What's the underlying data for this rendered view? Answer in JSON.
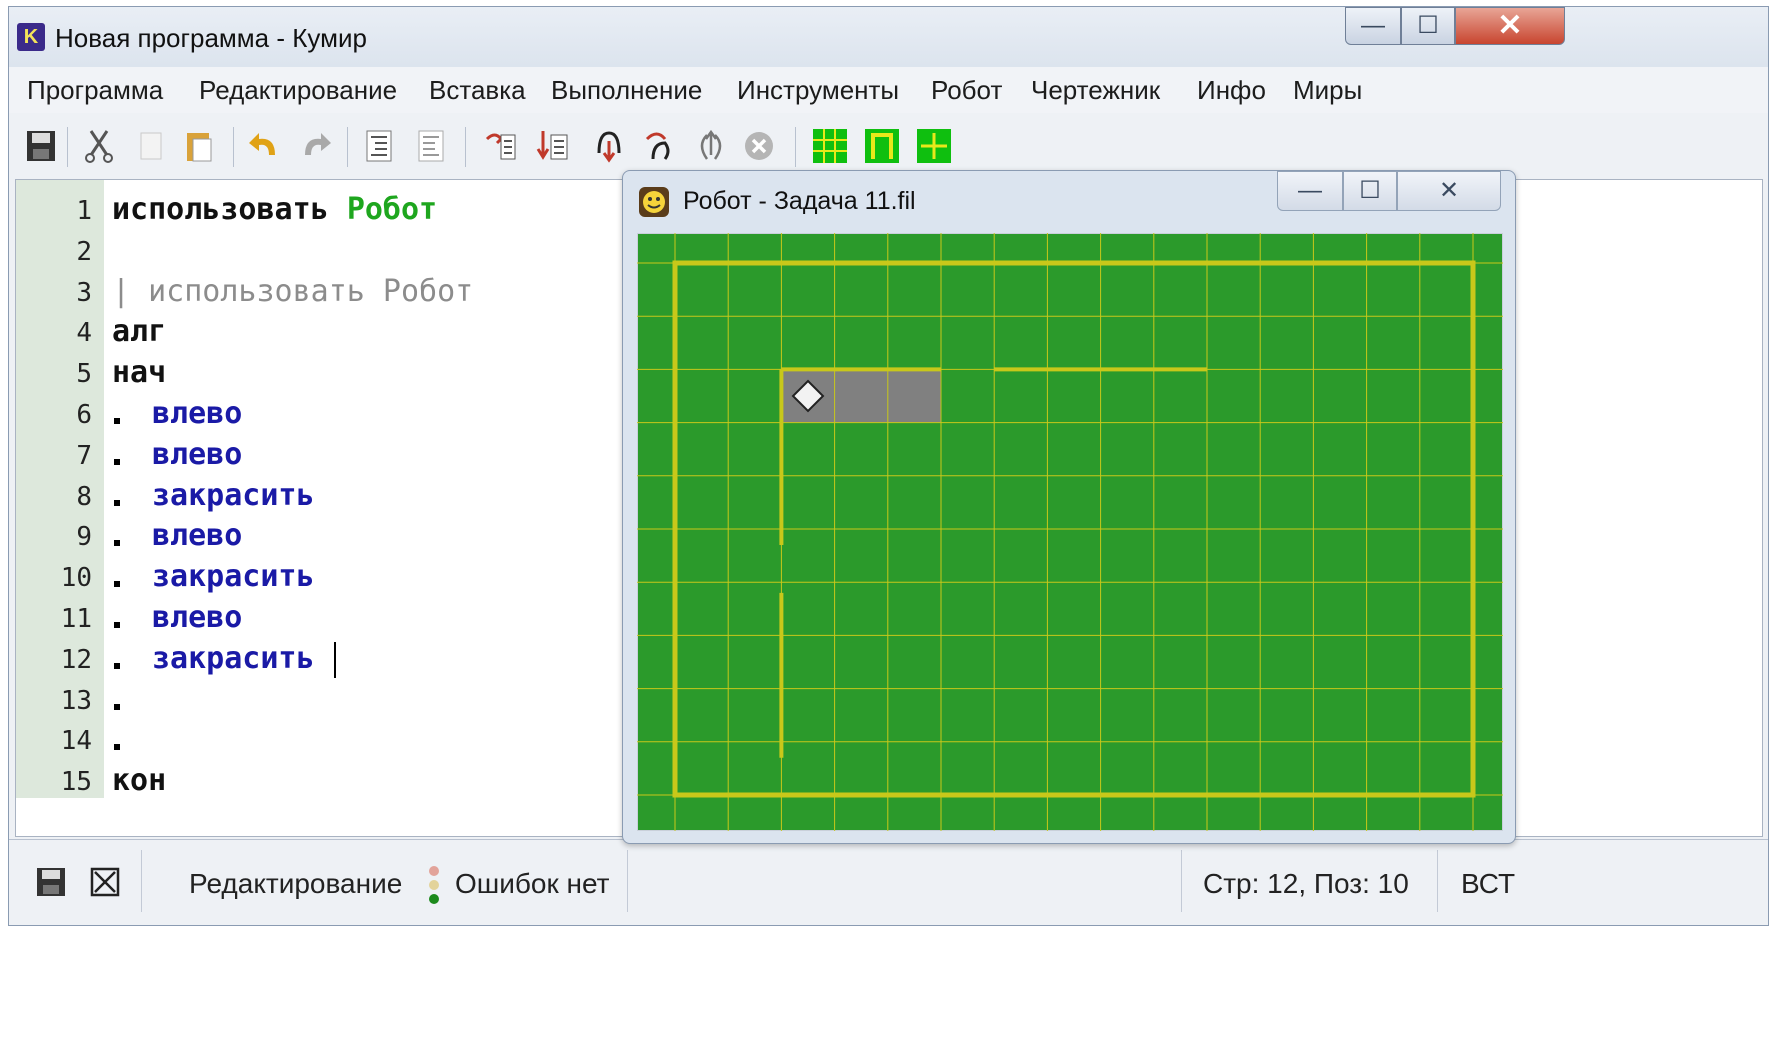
{
  "window": {
    "title": "Новая программа - Кумир",
    "logo": "K"
  },
  "menu": [
    "Программа",
    "Редактирование",
    "Вставка",
    "Выполнение",
    "Инструменты",
    "Робот",
    "Чертежник",
    "Инфо",
    "Миры"
  ],
  "toolbar_icons": [
    "save-icon",
    "cut-icon",
    "copy-icon",
    "paste-icon",
    "undo-icon",
    "redo-icon",
    "indent-icon",
    "unindent-icon",
    "run-icon",
    "step-icon",
    "step-into-icon",
    "step-out-icon",
    "step-back-icon",
    "stop-icon",
    "robot-grid-icon",
    "robot-field-icon",
    "drawer-icon"
  ],
  "editor": {
    "lines": [
      {
        "n": "1",
        "tokens": [
          [
            "kw",
            "использовать "
          ],
          [
            "green",
            "Робот"
          ]
        ]
      },
      {
        "n": "2",
        "tokens": []
      },
      {
        "n": "3",
        "tokens": [
          [
            "grey",
            "| использовать Робот"
          ]
        ]
      },
      {
        "n": "4",
        "tokens": [
          [
            "kw",
            "алг"
          ]
        ]
      },
      {
        "n": "5",
        "tokens": [
          [
            "kw",
            "нач"
          ]
        ]
      },
      {
        "n": "6",
        "tokens": [
          [
            "blue",
            "влево"
          ]
        ],
        "dot": true
      },
      {
        "n": "7",
        "tokens": [
          [
            "blue",
            "влево"
          ]
        ],
        "dot": true
      },
      {
        "n": "8",
        "tokens": [
          [
            "blue",
            "закрасить"
          ]
        ],
        "dot": true
      },
      {
        "n": "9",
        "tokens": [
          [
            "blue",
            "влево"
          ]
        ],
        "dot": true
      },
      {
        "n": "10",
        "tokens": [
          [
            "blue",
            "закрасить"
          ]
        ],
        "dot": true
      },
      {
        "n": "11",
        "tokens": [
          [
            "blue",
            "влево"
          ]
        ],
        "dot": true
      },
      {
        "n": "12",
        "tokens": [
          [
            "blue",
            "закрасить"
          ]
        ],
        "dot": true
      },
      {
        "n": "13",
        "tokens": [],
        "dot": true
      },
      {
        "n": "14",
        "tokens": [],
        "dot": true
      },
      {
        "n": "15",
        "tokens": [
          [
            "kw",
            "кон"
          ]
        ]
      }
    ]
  },
  "status": {
    "mode": "Редактирование",
    "errors": "Ошибок нет",
    "position": "Стр: 12, Поз: 10",
    "insert_mode": "ВСТ"
  },
  "robot_window": {
    "title": "Робот - Задача 11.fil",
    "field_color": "#2b9a2b",
    "wall_color": "#c8c81a",
    "painted_color": "#808080"
  }
}
